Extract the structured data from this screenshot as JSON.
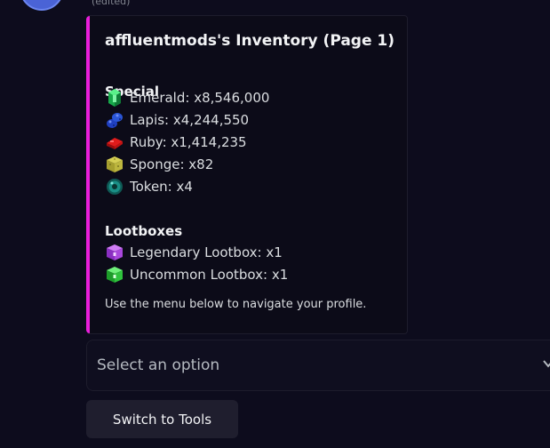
{
  "message": {
    "edited_label": "(edited)"
  },
  "embed": {
    "accent_color": "#e91edb",
    "title": "affluentmods's Inventory (Page 1)",
    "sections": [
      {
        "heading": "Special",
        "items": [
          {
            "icon": "emerald-icon",
            "text": "Emerald: x8,546,000"
          },
          {
            "icon": "lapis-icon",
            "text": "Lapis: x4,244,550"
          },
          {
            "icon": "ruby-icon",
            "text": "Ruby: x1,414,235"
          },
          {
            "icon": "sponge-icon",
            "text": "Sponge: x82"
          },
          {
            "icon": "token-icon",
            "text": "Token: x4"
          }
        ]
      },
      {
        "heading": "Lootboxes",
        "items": [
          {
            "icon": "legendary-lootbox-icon",
            "text": "Legendary Lootbox: x1"
          },
          {
            "icon": "uncommon-lootbox-icon",
            "text": "Uncommon Lootbox: x1"
          }
        ]
      }
    ],
    "footer": "Use the menu below to navigate your profile."
  },
  "select": {
    "placeholder": "Select an option",
    "icon": "chevron-down-icon"
  },
  "button": {
    "label": "Switch to Tools"
  }
}
